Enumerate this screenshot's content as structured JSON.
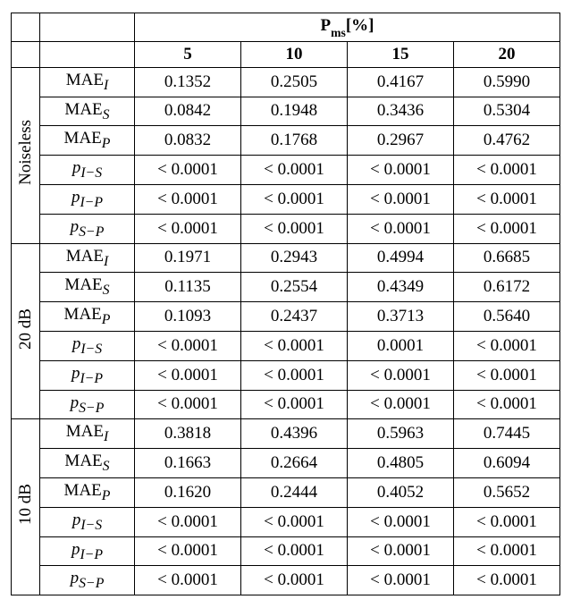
{
  "header": {
    "title_html": "P<sub>ms</sub>[%]",
    "cols": [
      "5",
      "10",
      "15",
      "20"
    ]
  },
  "groups": [
    {
      "name": "Noiseless",
      "rows": [
        {
          "label_html": "MAE<sub><i>I</i></sub>",
          "v": [
            "0.1352",
            "0.2505",
            "0.4167",
            "0.5990"
          ]
        },
        {
          "label_html": "MAE<sub><i>S</i></sub>",
          "v": [
            "0.0842",
            "0.1948",
            "0.3436",
            "0.5304"
          ]
        },
        {
          "label_html": "MAE<sub><i>P</i></sub>",
          "v": [
            "0.0832",
            "0.1768",
            "0.2967",
            "0.4762"
          ]
        },
        {
          "label_html": "<i>p</i><sub><i>I−S</i></sub>",
          "v": [
            "< 0.0001",
            "< 0.0001",
            "< 0.0001",
            "< 0.0001"
          ]
        },
        {
          "label_html": "<i>p</i><sub><i>I−P</i></sub>",
          "v": [
            "< 0.0001",
            "< 0.0001",
            "< 0.0001",
            "< 0.0001"
          ]
        },
        {
          "label_html": "<i>p</i><sub><i>S−P</i></sub>",
          "v": [
            "< 0.0001",
            "< 0.0001",
            "< 0.0001",
            "< 0.0001"
          ]
        }
      ]
    },
    {
      "name": "20 dB",
      "rows": [
        {
          "label_html": "MAE<sub><i>I</i></sub>",
          "v": [
            "0.1971",
            "0.2943",
            "0.4994",
            "0.6685"
          ]
        },
        {
          "label_html": "MAE<sub><i>S</i></sub>",
          "v": [
            "0.1135",
            "0.2554",
            "0.4349",
            "0.6172"
          ]
        },
        {
          "label_html": "MAE<sub><i>P</i></sub>",
          "v": [
            "0.1093",
            "0.2437",
            "0.3713",
            "0.5640"
          ]
        },
        {
          "label_html": "<i>p</i><sub><i>I−S</i></sub>",
          "v": [
            "< 0.0001",
            "< 0.0001",
            "0.0001",
            "< 0.0001"
          ]
        },
        {
          "label_html": "<i>p</i><sub><i>I−P</i></sub>",
          "v": [
            "< 0.0001",
            "< 0.0001",
            "< 0.0001",
            "< 0.0001"
          ]
        },
        {
          "label_html": "<i>p</i><sub><i>S−P</i></sub>",
          "v": [
            "< 0.0001",
            "< 0.0001",
            "< 0.0001",
            "< 0.0001"
          ]
        }
      ]
    },
    {
      "name": "10 dB",
      "rows": [
        {
          "label_html": "MAE<sub><i>I</i></sub>",
          "v": [
            "0.3818",
            "0.4396",
            "0.5963",
            "0.7445"
          ]
        },
        {
          "label_html": "MAE<sub><i>S</i></sub>",
          "v": [
            "0.1663",
            "0.2664",
            "0.4805",
            "0.6094"
          ]
        },
        {
          "label_html": "MAE<sub><i>P</i></sub>",
          "v": [
            "0.1620",
            "0.2444",
            "0.4052",
            "0.5652"
          ]
        },
        {
          "label_html": "<i>p</i><sub><i>I−S</i></sub>",
          "v": [
            "< 0.0001",
            "< 0.0001",
            "< 0.0001",
            "< 0.0001"
          ]
        },
        {
          "label_html": "<i>p</i><sub><i>I−P</i></sub>",
          "v": [
            "< 0.0001",
            "< 0.0001",
            "< 0.0001",
            "< 0.0001"
          ]
        },
        {
          "label_html": "<i>p</i><sub><i>S−P</i></sub>",
          "v": [
            "< 0.0001",
            "< 0.0001",
            "< 0.0001",
            "< 0.0001"
          ]
        }
      ]
    }
  ],
  "chart_data": {
    "type": "table",
    "column_header": "P_ms [%]",
    "columns": [
      5,
      10,
      15,
      20
    ],
    "groups": [
      {
        "condition": "Noiseless",
        "metrics": {
          "MAE_I": [
            0.1352,
            0.2505,
            0.4167,
            0.599
          ],
          "MAE_S": [
            0.0842,
            0.1948,
            0.3436,
            0.5304
          ],
          "MAE_P": [
            0.0832,
            0.1768,
            0.2967,
            0.4762
          ],
          "p_I-S": [
            "<0.0001",
            "<0.0001",
            "<0.0001",
            "<0.0001"
          ],
          "p_I-P": [
            "<0.0001",
            "<0.0001",
            "<0.0001",
            "<0.0001"
          ],
          "p_S-P": [
            "<0.0001",
            "<0.0001",
            "<0.0001",
            "<0.0001"
          ]
        }
      },
      {
        "condition": "20 dB",
        "metrics": {
          "MAE_I": [
            0.1971,
            0.2943,
            0.4994,
            0.6685
          ],
          "MAE_S": [
            0.1135,
            0.2554,
            0.4349,
            0.6172
          ],
          "MAE_P": [
            0.1093,
            0.2437,
            0.3713,
            0.564
          ],
          "p_I-S": [
            "<0.0001",
            "<0.0001",
            "0.0001",
            "<0.0001"
          ],
          "p_I-P": [
            "<0.0001",
            "<0.0001",
            "<0.0001",
            "<0.0001"
          ],
          "p_S-P": [
            "<0.0001",
            "<0.0001",
            "<0.0001",
            "<0.0001"
          ]
        }
      },
      {
        "condition": "10 dB",
        "metrics": {
          "MAE_I": [
            0.3818,
            0.4396,
            0.5963,
            0.7445
          ],
          "MAE_S": [
            0.1663,
            0.2664,
            0.4805,
            0.6094
          ],
          "MAE_P": [
            0.162,
            0.2444,
            0.4052,
            0.5652
          ],
          "p_I-S": [
            "<0.0001",
            "<0.0001",
            "<0.0001",
            "<0.0001"
          ],
          "p_I-P": [
            "<0.0001",
            "<0.0001",
            "<0.0001",
            "<0.0001"
          ],
          "p_S-P": [
            "<0.0001",
            "<0.0001",
            "<0.0001",
            "<0.0001"
          ]
        }
      }
    ]
  }
}
